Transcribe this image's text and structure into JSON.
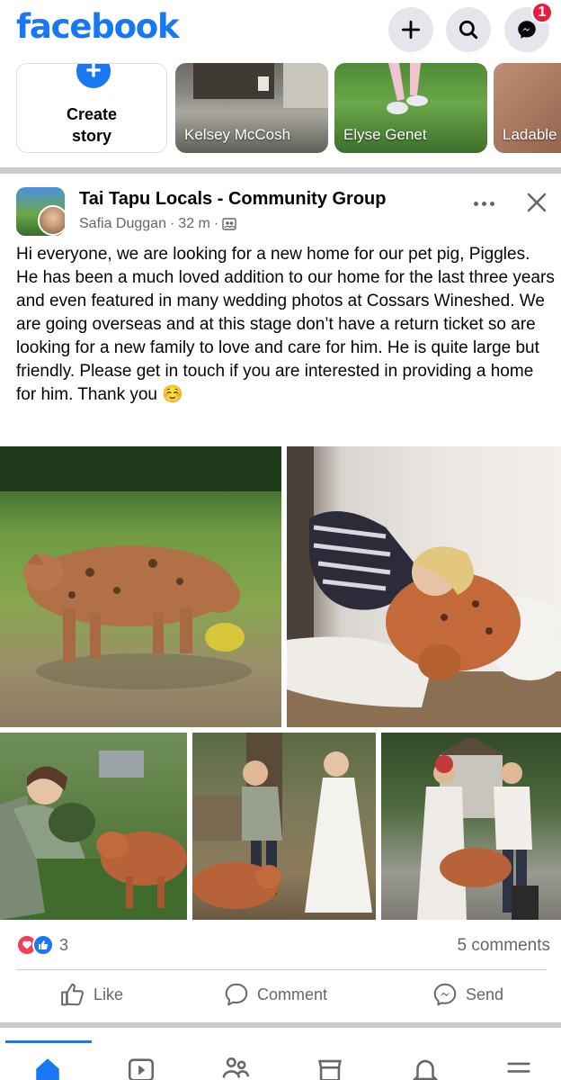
{
  "header": {
    "logo_text": "facebook",
    "notification_count": "1",
    "brand_color": "#1877f2",
    "icons": [
      "plus-icon",
      "search-icon",
      "messenger-icon"
    ]
  },
  "stories": {
    "create_label_line1": "Create",
    "create_label_line2": "story",
    "items": [
      {
        "name": "Kelsey McCosh"
      },
      {
        "name": "Elyse Genet"
      },
      {
        "name": "Ladable"
      }
    ]
  },
  "post": {
    "group_name": "Tai Tapu Locals - Community Group",
    "author": "Safia Duggan",
    "separator": "·",
    "time": "32 m",
    "audience_icon": "group-audience-icon",
    "text": "Hi everyone, we are looking for a new home for our pet pig, Piggles. He has been a much loved addition to our home for the last three years and even featured in many wedding photos at Cossars Wineshed. We are going overseas and at this stage don’t have a return ticket so are looking for a new family to love and care for him. He is quite large but friendly. Please get in touch if you are interested in providing a home for him. Thank you ☺️",
    "reactions_count": "3",
    "comments_label": "5 comments",
    "actions": {
      "like": "Like",
      "comment": "Comment",
      "send": "Send"
    }
  },
  "bottom_nav": {
    "items": [
      "home-icon",
      "video-icon",
      "friends-icon",
      "marketplace-icon",
      "notifications-icon",
      "menu-icon"
    ],
    "active": "home-icon"
  }
}
